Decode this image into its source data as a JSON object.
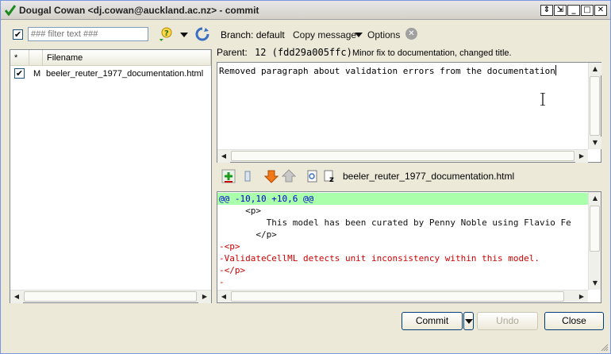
{
  "window": {
    "title": "Dougal Cowan <dj.cowan@auckland.ac.nz> - commit",
    "controls": [
      "⇕",
      "⇲",
      "_",
      "□",
      "✕"
    ]
  },
  "toolbar": {
    "select_all_check": "✔",
    "filter_placeholder": "### filter text ###",
    "branch_label": "Branch: default",
    "copy_message_label": "Copy message",
    "options_label": "Options",
    "clear_glyph": "✕"
  },
  "filelist": {
    "columns": [
      "*",
      "",
      "Filename"
    ],
    "files": [
      {
        "checked": "✔",
        "status": "M",
        "name": "beeler_reuter_1977_documentation.html"
      }
    ]
  },
  "parent": {
    "label": "Parent:",
    "rev": "12 (fdd29a005ffc)",
    "description": "Minor fix to documentation, changed title."
  },
  "commit_message": "Removed paragraph about validation errors from the documentation",
  "diff": {
    "filename": "beeler_reuter_1977_documentation.html",
    "lines": [
      {
        "type": "hunk",
        "text": "@@ -10,10 +10,6 @@"
      },
      {
        "type": "ctx",
        "text": "     <p>"
      },
      {
        "type": "ctx",
        "text": "         This model has been curated by Penny Noble using Flavio Fe"
      },
      {
        "type": "ctx",
        "text": "       </p>"
      },
      {
        "type": "del",
        "text": "-<p>"
      },
      {
        "type": "del",
        "text": "-ValidateCellML detects unit inconsistency within this model."
      },
      {
        "type": "del",
        "text": "-</p>"
      },
      {
        "type": "del",
        "text": "-"
      }
    ]
  },
  "buttons": {
    "commit": "Commit",
    "undo": "Undo",
    "close": "Close"
  },
  "colors": {
    "hunk_bg": "#aaffaa",
    "deleted_text": "#cc0000",
    "hunk_text": "#0000cc"
  }
}
